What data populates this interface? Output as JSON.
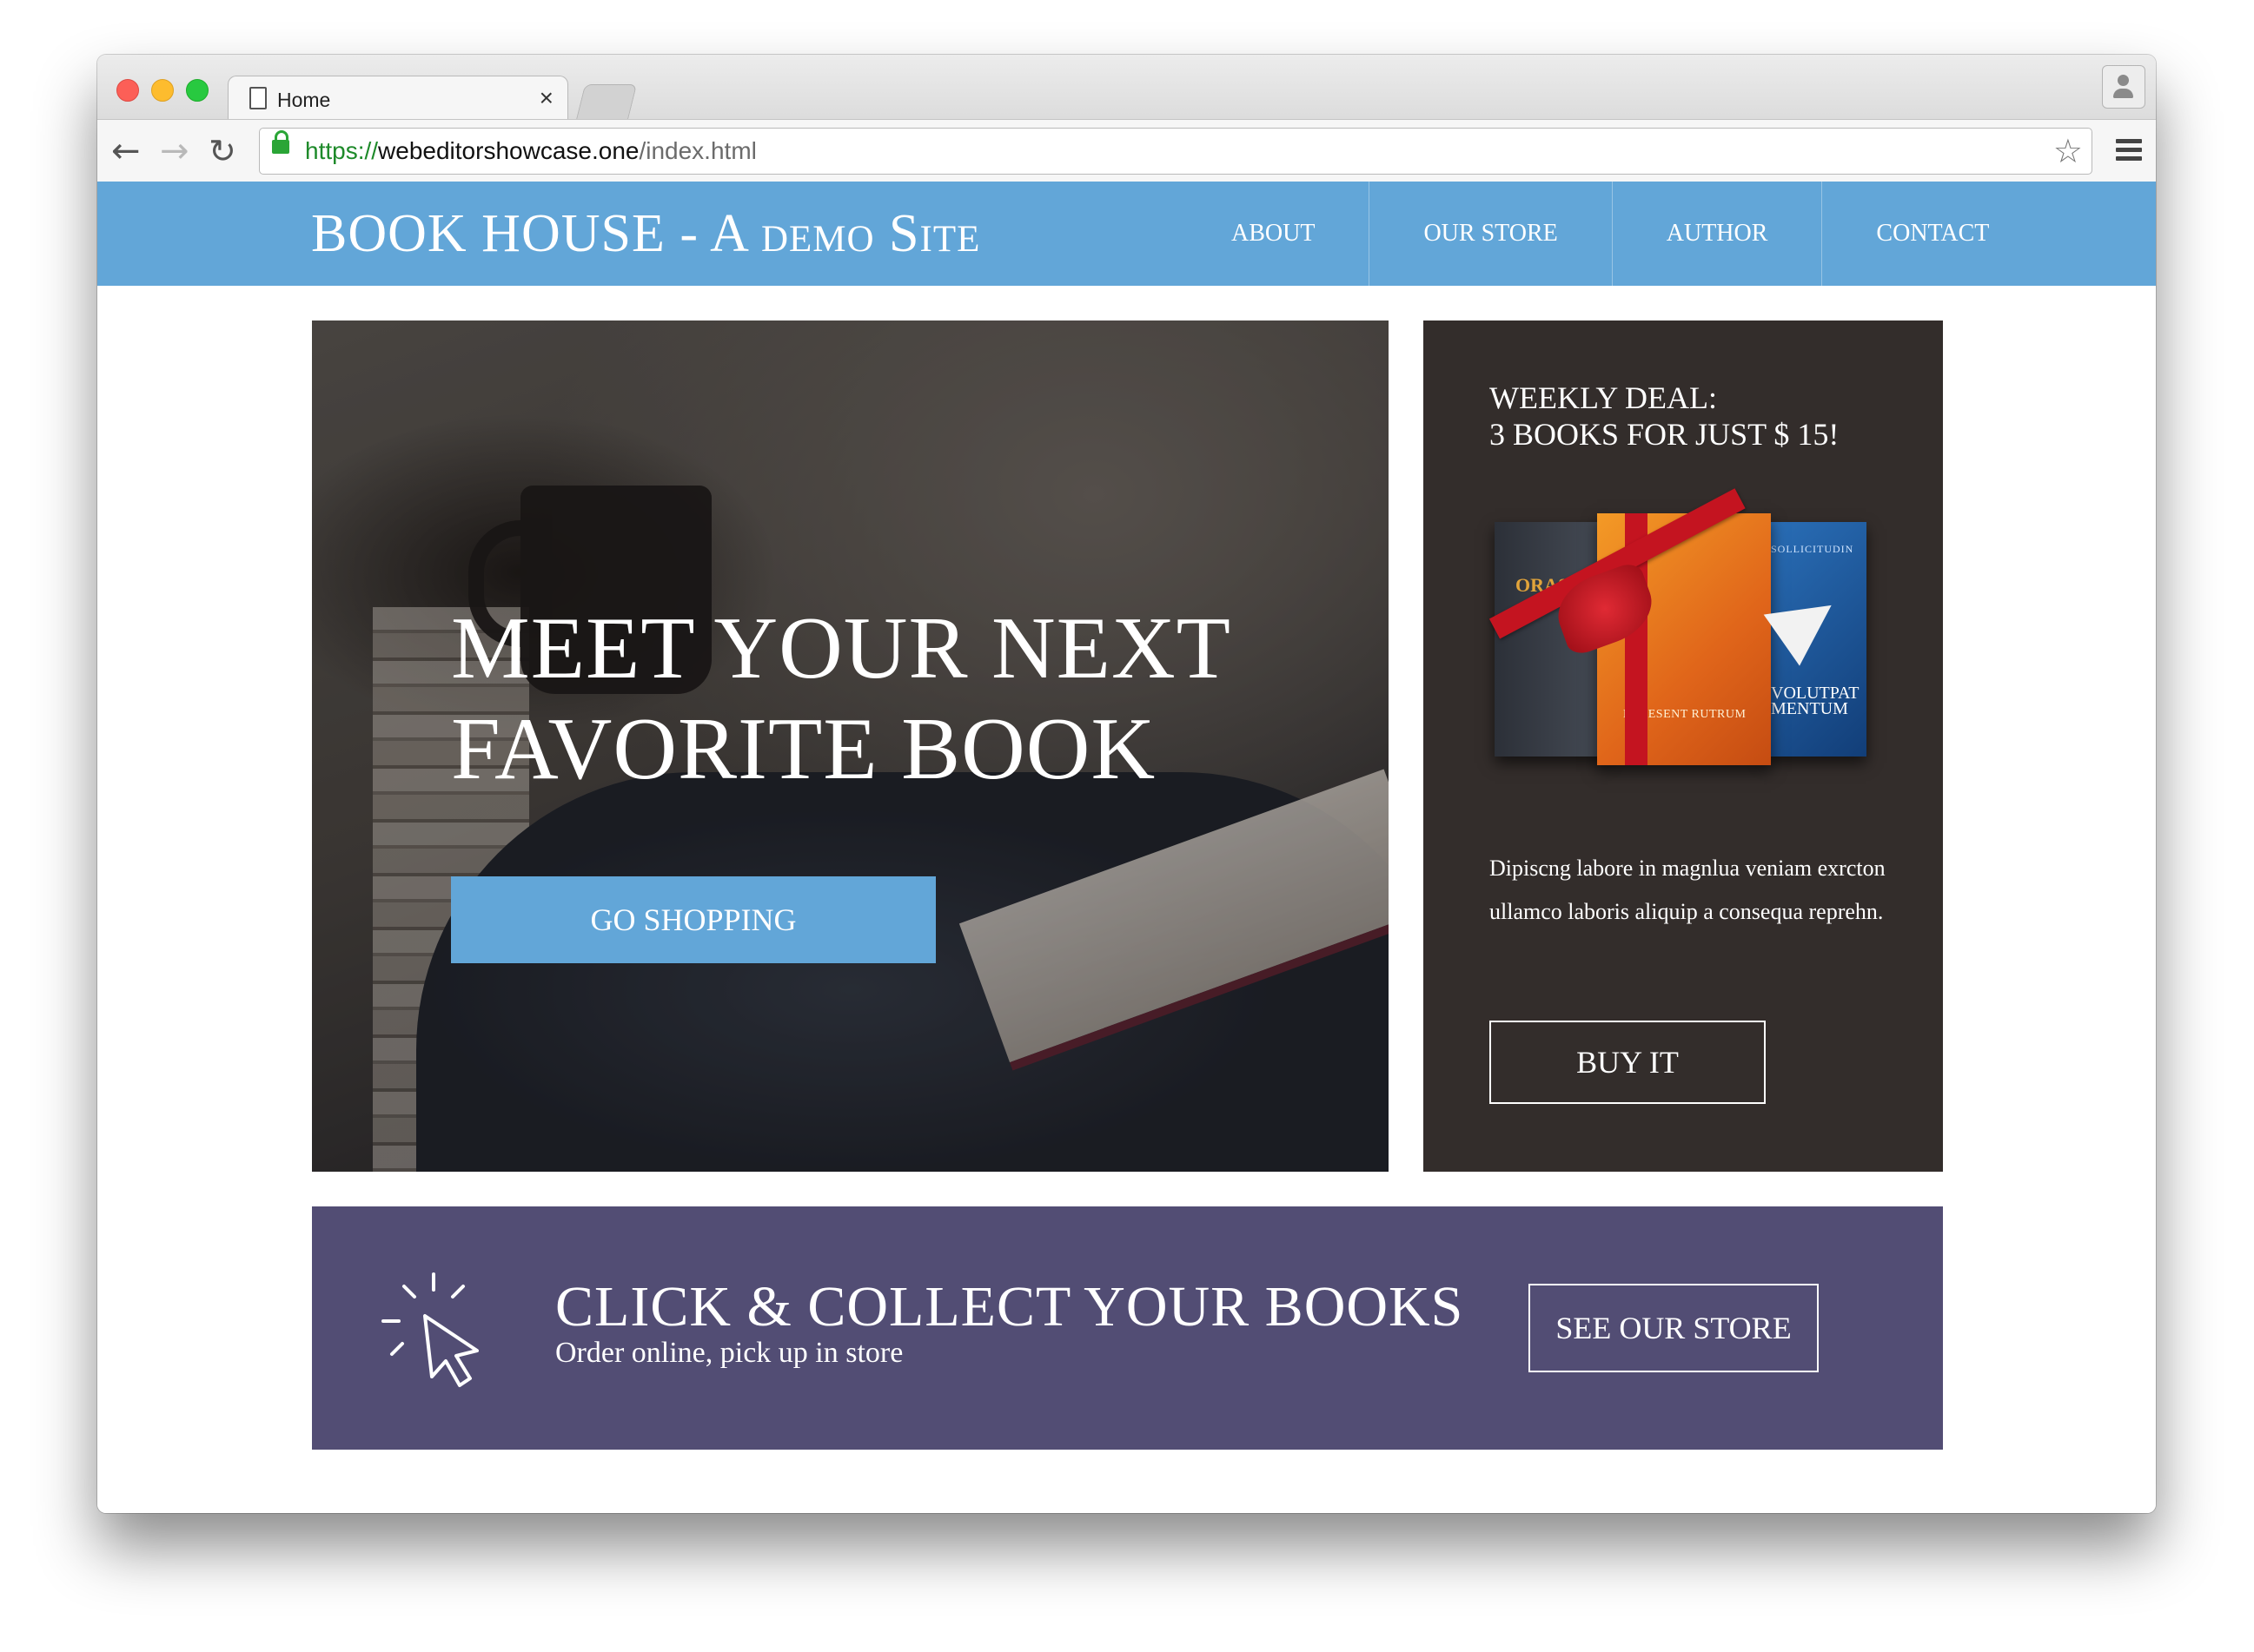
{
  "browser": {
    "tab_title": "Home",
    "tab_close": "×",
    "url_scheme": "https://",
    "url_host": "webeditorshowcase.one",
    "url_path": "/index.html",
    "back_icon": "arrow-left-icon",
    "forward_icon": "arrow-right-icon",
    "reload_icon": "reload-icon",
    "bookmark_icon": "star-icon",
    "menu_icon": "hamburger-menu-icon",
    "profile_icon": "user-icon"
  },
  "site": {
    "title_main": "BOOK HOUSE - A ",
    "title_small_caps": "demo Site",
    "header_color": "#62a6d8",
    "nav": [
      {
        "label": "ABOUT"
      },
      {
        "label": "OUR STORE"
      },
      {
        "label": "AUTHOR"
      },
      {
        "label": "CONTACT"
      }
    ]
  },
  "hero": {
    "headline_line1": "MEET YOUR NEXT",
    "headline_line2": "FAVORITE BOOK",
    "cta_label": "GO SHOPPING"
  },
  "deal": {
    "title_line1": "WEEKLY DEAL:",
    "title_line2": "3 BOOKS FOR JUST $ 15!",
    "book_caption_center": "PRAESENT RUTRUM",
    "book_caption_right_top": "SOLLICITUDIN",
    "book_caption_right": "VOLUTPAT MENTUM",
    "book_caption_left": "ORAS",
    "description": "Dipiscng labore in magnlua veniam exrcton ullamco laboris aliquip a consequa reprehn.",
    "button_label": "BUY IT",
    "background_color": "#332d2b"
  },
  "banner": {
    "title": "CLICK & COLLECT YOUR BOOKS",
    "subtitle": "Order online, pick up in store",
    "button_label": "SEE OUR STORE",
    "icon": "cursor-click-icon",
    "background_color": "#524d74"
  }
}
